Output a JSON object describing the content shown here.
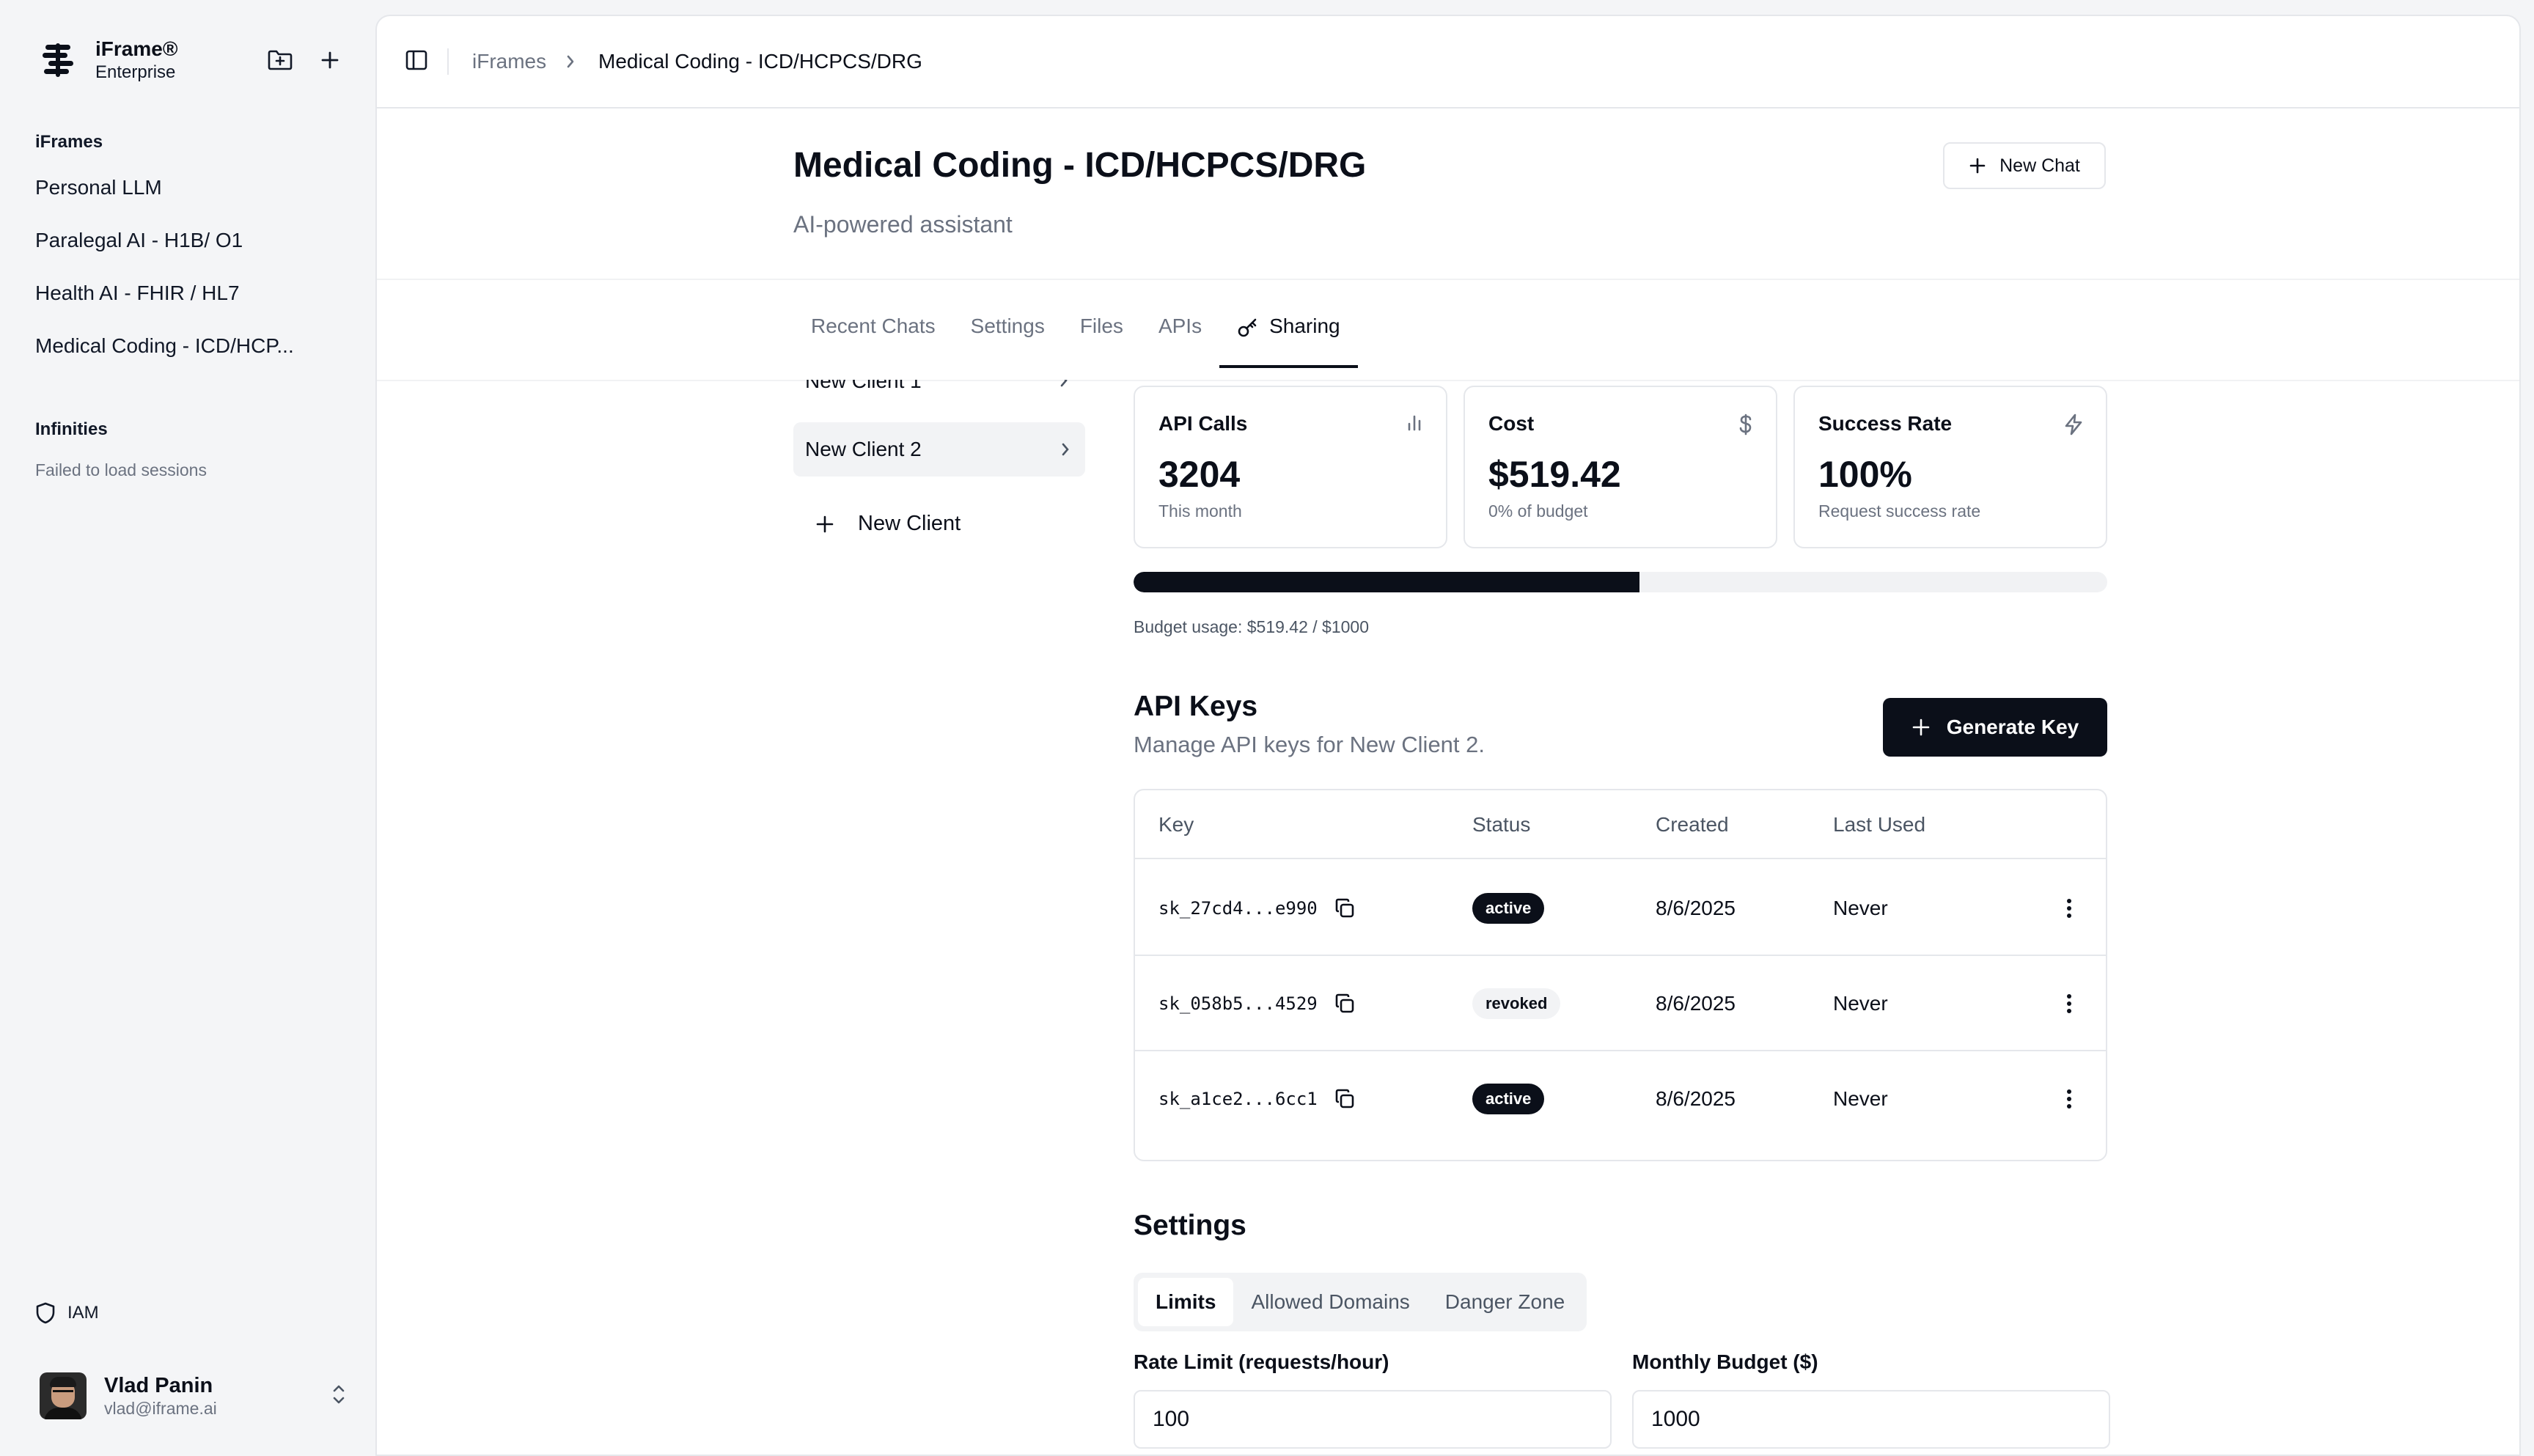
{
  "brand": {
    "name": "iFrame®",
    "tier": "Enterprise"
  },
  "sidebar": {
    "section_iframes": "iFrames",
    "items": [
      {
        "label": "Personal LLM"
      },
      {
        "label": "Paralegal AI - H1B/ O1"
      },
      {
        "label": "Health AI - FHIR / HL7"
      },
      {
        "label": "Medical Coding - ICD/HCP..."
      }
    ],
    "section_infinities": "Infinities",
    "infinities_status": "Failed to load sessions",
    "iam_label": "IAM"
  },
  "user": {
    "name": "Vlad Panin",
    "email": "vlad@iframe.ai"
  },
  "breadcrumb": {
    "root": "iFrames",
    "current": "Medical Coding - ICD/HCPCS/DRG"
  },
  "page": {
    "title": "Medical Coding - ICD/HCPCS/DRG",
    "subtitle": "AI-powered assistant",
    "new_chat_label": "New Chat"
  },
  "tabs": [
    {
      "label": "Recent Chats"
    },
    {
      "label": "Settings"
    },
    {
      "label": "Files"
    },
    {
      "label": "APIs"
    },
    {
      "label": "Sharing",
      "active": true
    }
  ],
  "clients": {
    "partial_item": "New Client 1",
    "selected_item": "New Client 2",
    "add_label": "New Client"
  },
  "stats": {
    "api_calls": {
      "label": "API Calls",
      "value": "3204",
      "note": "This month"
    },
    "cost": {
      "label": "Cost",
      "value": "$519.42",
      "note": "0% of budget"
    },
    "success": {
      "label": "Success Rate",
      "value": "100%",
      "note": "Request success rate"
    }
  },
  "budget": {
    "usage_text": "Budget usage: $519.42 / $1000",
    "fraction": 0.51942
  },
  "api_keys": {
    "title": "API Keys",
    "subtitle": "Manage API keys for New Client 2.",
    "generate_label": "Generate Key",
    "columns": {
      "key": "Key",
      "status": "Status",
      "created": "Created",
      "last_used": "Last Used"
    },
    "rows": [
      {
        "key": "sk_27cd4...e990",
        "status": "active",
        "created": "8/6/2025",
        "last_used": "Never"
      },
      {
        "key": "sk_058b5...4529",
        "status": "revoked",
        "created": "8/6/2025",
        "last_used": "Never"
      },
      {
        "key": "sk_a1ce2...6cc1",
        "status": "active",
        "created": "8/6/2025",
        "last_used": "Never"
      }
    ]
  },
  "settings": {
    "title": "Settings",
    "tabs": [
      {
        "label": "Limits",
        "active": true
      },
      {
        "label": "Allowed Domains"
      },
      {
        "label": "Danger Zone"
      }
    ],
    "rate_limit_label": "Rate Limit (requests/hour)",
    "rate_limit_value": "100",
    "budget_label": "Monthly Budget ($)",
    "budget_value": "1000"
  },
  "colors": {
    "primary": "#0b0f19",
    "muted": "#6b7280",
    "border": "#e5e7eb",
    "sidebar_bg": "#f4f5f7"
  }
}
